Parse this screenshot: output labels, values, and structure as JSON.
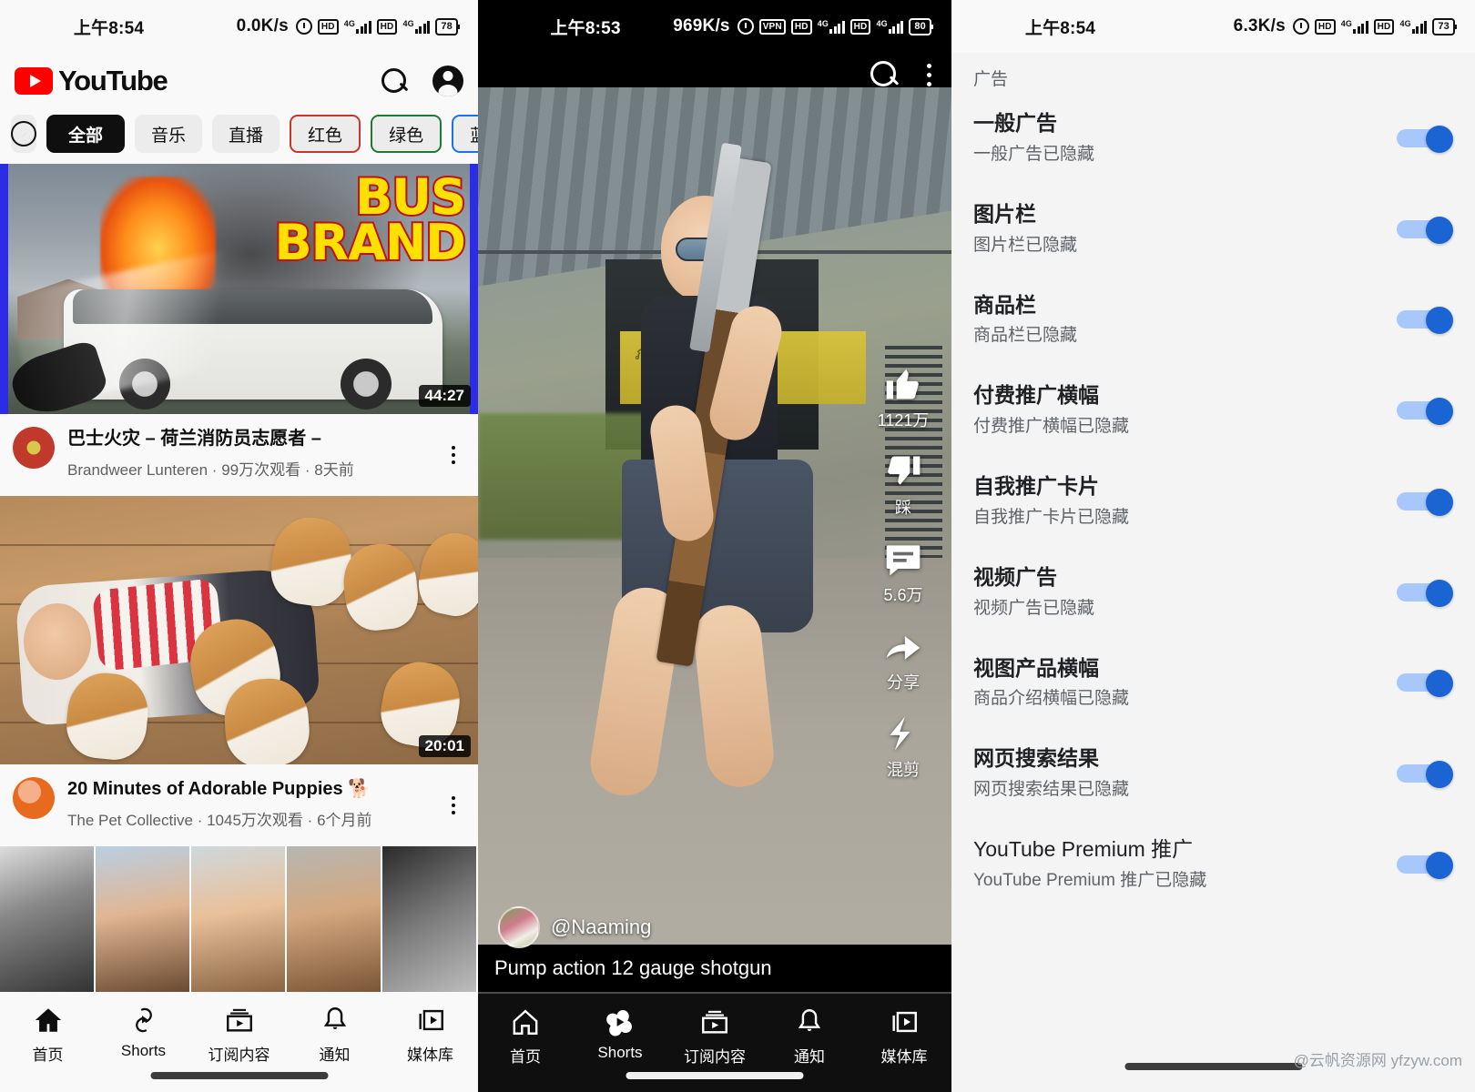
{
  "panels": {
    "home": {
      "status": {
        "time": "上午8:54",
        "speed": "0.0K/s",
        "battery": "78",
        "net1": "4G",
        "net2": "4G",
        "hd": "HD"
      },
      "header": {
        "brand": "YouTube",
        "search_icon": "search-icon",
        "avatar_icon": "account-avatar-icon"
      },
      "chips": [
        {
          "label": "",
          "icon": "compass-icon",
          "style": "compass"
        },
        {
          "label": "全部",
          "style": "active"
        },
        {
          "label": "音乐",
          "style": "plain"
        },
        {
          "label": "直播",
          "style": "plain"
        },
        {
          "label": "红色",
          "style": "outline-red"
        },
        {
          "label": "绿色",
          "style": "outline-green"
        },
        {
          "label": "蓝色",
          "style": "outline-blue"
        }
      ],
      "videos": [
        {
          "title": "巴士火灾 – 荷兰消防员志愿者 –",
          "channel": "Brandweer Lunteren",
          "views": "99万次观看",
          "age": "8天前",
          "duration": "44:27",
          "thumb_text_line1": "BUS",
          "thumb_text_line2": "BRAND"
        },
        {
          "title": "20 Minutes of Adorable Puppies 🐕",
          "channel": "The Pet Collective",
          "views": "1045万次观看",
          "age": "6个月前",
          "duration": "20:01"
        }
      ],
      "separator": "·",
      "nav": [
        {
          "label": "首页",
          "icon": "home-icon"
        },
        {
          "label": "Shorts",
          "icon": "shorts-icon"
        },
        {
          "label": "订阅内容",
          "icon": "subscriptions-icon"
        },
        {
          "label": "通知",
          "icon": "bell-icon"
        },
        {
          "label": "媒体库",
          "icon": "library-icon"
        }
      ]
    },
    "shorts": {
      "status": {
        "time": "上午8:53",
        "speed": "969K/s",
        "battery": "80",
        "vpn": "VPN",
        "net1": "4G",
        "net2": "4G",
        "hd": "HD"
      },
      "topbar": {
        "search_icon": "search-icon",
        "more_icon": "more-vertical-icon"
      },
      "actions": [
        {
          "icon": "thumbs-up-icon",
          "label": "1121万"
        },
        {
          "icon": "thumbs-down-icon",
          "label": "踩"
        },
        {
          "icon": "comment-icon",
          "label": "5.6万"
        },
        {
          "icon": "share-icon",
          "label": "分享"
        },
        {
          "icon": "remix-icon",
          "label": "混剪"
        }
      ],
      "author": "@Naaming",
      "caption": "Pump action 12 gauge shotgun",
      "nav": [
        {
          "label": "首页",
          "icon": "home-icon"
        },
        {
          "label": "Shorts",
          "icon": "shorts-icon"
        },
        {
          "label": "订阅内容",
          "icon": "subscriptions-icon"
        },
        {
          "label": "通知",
          "icon": "bell-icon"
        },
        {
          "label": "媒体库",
          "icon": "library-icon"
        }
      ]
    },
    "settings": {
      "status": {
        "time": "上午8:54",
        "speed": "6.3K/s",
        "battery": "73",
        "net1": "4G",
        "net2": "4G",
        "hd": "HD"
      },
      "section_header": "广告",
      "accent_on": "#1a64d4",
      "accent_track": "#a8c7fa",
      "items": [
        {
          "title": "一般广告",
          "summary": "一般广告已隐藏",
          "enabled": true
        },
        {
          "title": "图片栏",
          "summary": "图片栏已隐藏",
          "enabled": true
        },
        {
          "title": "商品栏",
          "summary": "商品栏已隐藏",
          "enabled": true
        },
        {
          "title": "付费推广横幅",
          "summary": "付费推广横幅已隐藏",
          "enabled": true
        },
        {
          "title": "自我推广卡片",
          "summary": "自我推广卡片已隐藏",
          "enabled": true
        },
        {
          "title": "视频广告",
          "summary": "视频广告已隐藏",
          "enabled": true
        },
        {
          "title": "视图产品横幅",
          "summary": "商品介绍横幅已隐藏",
          "enabled": true
        },
        {
          "title": "网页搜索结果",
          "summary": "网页搜索结果已隐藏",
          "enabled": true
        },
        {
          "title": "YouTube Premium 推广",
          "summary": "YouTube Premium 推广已隐藏",
          "enabled": true
        }
      ],
      "watermark": "@云帆资源网 yfzyw.com"
    }
  }
}
